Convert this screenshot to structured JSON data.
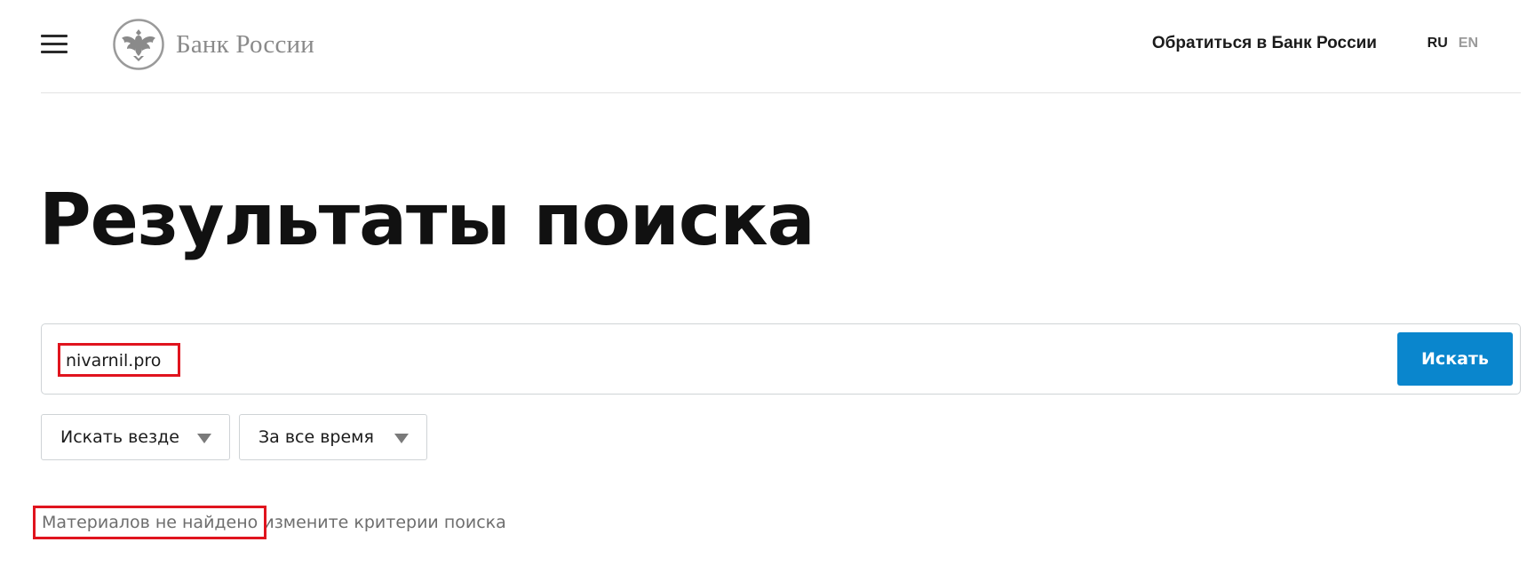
{
  "header": {
    "logo_text": "Банк России",
    "contact_link": "Обратиться в Банк России",
    "lang": {
      "ru": "RU",
      "en": "EN"
    }
  },
  "page": {
    "title": "Результаты поиска"
  },
  "search": {
    "query": "nivarnil.pro",
    "button_label": "Искать"
  },
  "filters": [
    {
      "label": "Искать везде"
    },
    {
      "label": "За все время"
    }
  ],
  "results": {
    "not_found": "Материалов не найдено",
    "hint": "измените критерии поиска"
  },
  "colors": {
    "accent": "#0a86cd",
    "highlight": "#e0141e",
    "muted_text": "#6e6e6e"
  }
}
